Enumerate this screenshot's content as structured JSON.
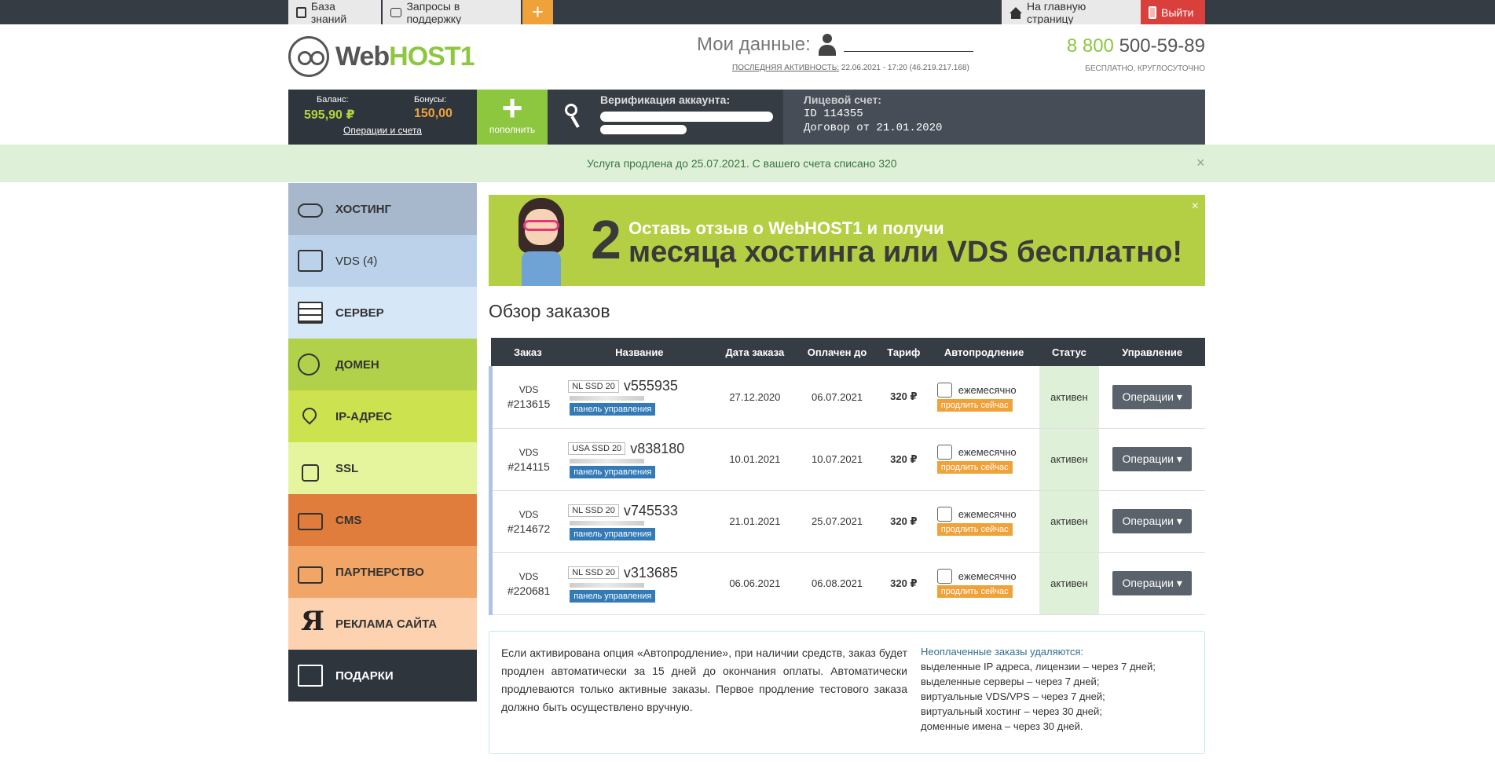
{
  "topbar": {
    "knowledge_base": "База знаний",
    "support": "Запросы в поддержку",
    "add": "+",
    "home": "На главную страницу",
    "logout": "Выйти"
  },
  "header": {
    "logo_web": "Web",
    "logo_host": "HOST1",
    "my_data": "Мои данные:",
    "last_activity_label": "ПОСЛЕДНЯЯ АКТИВНОСТЬ:",
    "last_activity_value": "22.06.2021 - 17:20 (46.219.217.168)",
    "phone_prefix": "8 800",
    "phone_number": "500-59-89",
    "phone_note": "БЕСПЛАТНО, КРУГЛОСУТОЧНО"
  },
  "account": {
    "balance_label": "Баланс:",
    "balance_value": "595,90 ₽",
    "bonus_label": "Бонусы:",
    "bonus_value": "150,00",
    "operations_link": "Операции и счета",
    "topup_label": "пополнить",
    "verification_title": "Верификация аккаунта:",
    "account_title": "Лицевой счет:",
    "account_id": "ID 114355",
    "contract": "Договор от 21.01.2020"
  },
  "notice": {
    "text": "Услуга продлена до 25.07.2021. С вашего счета списано 320",
    "close": "×"
  },
  "sidebar": {
    "items": [
      {
        "label": "ХОСТИНГ",
        "bg": "#a7b7cc"
      },
      {
        "label": "VDS (4)",
        "bg": "#bcd2ea"
      },
      {
        "label": "СЕРВЕР",
        "bg": "#d6e7f8"
      },
      {
        "label": "ДОМЕН",
        "bg": "#b1d14b"
      },
      {
        "label": "IP-АДРЕС",
        "bg": "#cde24f"
      },
      {
        "label": "SSL",
        "bg": "#e4f59d"
      },
      {
        "label": "CMS",
        "bg": "#e17d3c"
      },
      {
        "label": "ПАРТНЕРСТВО",
        "bg": "#f1a566"
      },
      {
        "label": "РЕКЛАМА САЙТА",
        "bg": "#fcd2b0"
      },
      {
        "label": "ПОДАРКИ",
        "bg": "#2f353c"
      }
    ]
  },
  "banner": {
    "number": "2",
    "line1": "Оставь отзыв о WebHOST1 и получи",
    "line2a": "месяца хостинга или ",
    "line2b": "VDS",
    "line2c": " бесплатно!",
    "close": "×"
  },
  "orders": {
    "title": "Обзор заказов",
    "columns": [
      "Заказ",
      "Название",
      "Дата заказа",
      "Оплачен до",
      "Тариф",
      "Автопродление",
      "Статус",
      "Управление"
    ],
    "panel_label": "панель управления",
    "monthly_label": "ежемесячно",
    "renew_label": "продлить сейчас",
    "ops_label": "Операции ▾",
    "rows": [
      {
        "kind": "VDS",
        "num": "#213615",
        "plan": "NL SSD 20",
        "name": "v555935",
        "date": "27.12.2020",
        "paid_until": "06.07.2021",
        "price": "320 ₽",
        "status": "активен"
      },
      {
        "kind": "VDS",
        "num": "#214115",
        "plan": "USA SSD 20",
        "name": "v838180",
        "date": "10.01.2021",
        "paid_until": "10.07.2021",
        "price": "320 ₽",
        "status": "активен"
      },
      {
        "kind": "VDS",
        "num": "#214672",
        "plan": "NL SSD 20",
        "name": "v745533",
        "date": "21.01.2021",
        "paid_until": "25.07.2021",
        "price": "320 ₽",
        "status": "активен"
      },
      {
        "kind": "VDS",
        "num": "#220681",
        "plan": "NL SSD 20",
        "name": "v313685",
        "date": "06.06.2021",
        "paid_until": "06.08.2021",
        "price": "320 ₽",
        "status": "активен"
      }
    ]
  },
  "info": {
    "left": "Если активирована опция «Автопродление», при наличии средств, заказ будет продлен автоматически за 15 дней до окончания оплаты. Автоматически продлеваются только активные заказы. Первое продление тестового заказа должно быть осуществлено вручную.",
    "right_title": "Неоплаченные заказы удаляются:",
    "right_lines": [
      "выделенные IP адреса, лицензии – через 7 дней;",
      "выделенные серверы – через 7 дней;",
      "виртуальные VDS/VPS – через 7 дней;",
      "виртуальный хостинг – через 30 дней;",
      "доменные имена – через 30 дней."
    ]
  }
}
